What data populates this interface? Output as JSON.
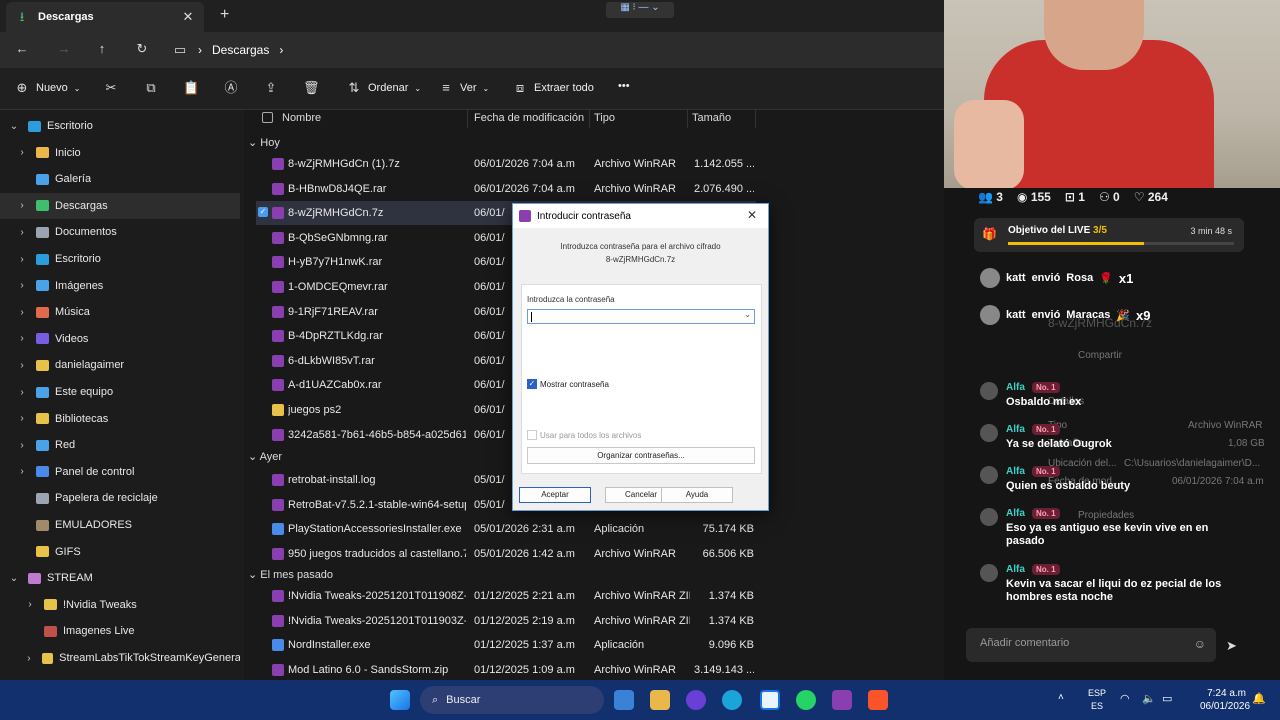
{
  "explorer": {
    "tab_title": "Descargas",
    "breadcrumb": [
      "Descargas"
    ],
    "commands": {
      "new": "Nuevo",
      "sort": "Ordenar",
      "view": "Ver",
      "extract": "Extraer todo",
      "more": "•••"
    },
    "sidebar": [
      {
        "label": "Escritorio",
        "level": 0,
        "chev": "v",
        "color": "#2d9cdb"
      },
      {
        "label": "Inicio",
        "level": 1,
        "chev": ">",
        "color": "#e8b84a"
      },
      {
        "label": "Galería",
        "level": 1,
        "chev": "",
        "color": "#4aa3e8"
      },
      {
        "label": "Descargas",
        "level": 1,
        "chev": ">",
        "color": "#3fbf6e"
      },
      {
        "label": "Documentos",
        "level": 1,
        "chev": ">",
        "color": "#9aa5b1"
      },
      {
        "label": "Escritorio",
        "level": 1,
        "chev": ">",
        "color": "#2d9cdb"
      },
      {
        "label": "Imágenes",
        "level": 1,
        "chev": ">",
        "color": "#4aa3e8"
      },
      {
        "label": "Música",
        "level": 1,
        "chev": ">",
        "color": "#e06a4a"
      },
      {
        "label": "Videos",
        "level": 1,
        "chev": ">",
        "color": "#7a5ce0"
      },
      {
        "label": "danielagaimer",
        "level": 1,
        "chev": ">",
        "color": "#e8c14a"
      },
      {
        "label": "Este equipo",
        "level": 1,
        "chev": ">",
        "color": "#4aa3e8"
      },
      {
        "label": "Bibliotecas",
        "level": 1,
        "chev": ">",
        "color": "#e8c14a"
      },
      {
        "label": "Red",
        "level": 1,
        "chev": ">",
        "color": "#4aa3e8"
      },
      {
        "label": "Panel de control",
        "level": 1,
        "chev": ">",
        "color": "#4a8ae8"
      },
      {
        "label": "Papelera de reciclaje",
        "level": 1,
        "chev": "",
        "color": "#9aa5b1"
      },
      {
        "label": "EMULADORES",
        "level": 1,
        "chev": "",
        "color": "#a08a6a"
      },
      {
        "label": "GIFS",
        "level": 1,
        "chev": "",
        "color": "#e8c14a"
      },
      {
        "label": "STREAM",
        "level": 0,
        "chev": "v",
        "color": "#c07ad0"
      },
      {
        "label": "!Nvidia Tweaks",
        "level": 2,
        "chev": ">",
        "color": "#e8c14a"
      },
      {
        "label": "Imagenes Live",
        "level": 2,
        "chev": "",
        "color": "#c0504a"
      },
      {
        "label": "StreamLabsTikTokStreamKeyGeneratorRe",
        "level": 2,
        "chev": ">",
        "color": "#e8c14a"
      }
    ],
    "columns": [
      "Nombre",
      "Fecha de modificación",
      "Tipo",
      "Tamaño"
    ],
    "groups": [
      {
        "title": "Hoy",
        "files": [
          {
            "name": "8-wZjRMHGdCn (1).7z",
            "date": "06/01/2026 7:04 a.m",
            "type": "Archivo WinRAR",
            "size": "1.142.055 ..."
          },
          {
            "name": "B-HBnwD8J4QE.rar",
            "date": "06/01/2026 7:04 a.m",
            "type": "Archivo WinRAR",
            "size": "2.076.490 ..."
          },
          {
            "name": "8-wZjRMHGdCn.7z",
            "date": "06/01/",
            "type": "",
            "size": "",
            "selected": true
          },
          {
            "name": "B-QbSeGNbmng.rar",
            "date": "06/01/",
            "type": "",
            "size": ""
          },
          {
            "name": "H-yB7y7H1nwK.rar",
            "date": "06/01/",
            "type": "",
            "size": ""
          },
          {
            "name": "1-OMDCEQmevr.rar",
            "date": "06/01/",
            "type": "",
            "size": ""
          },
          {
            "name": "9-1RjF71REAV.rar",
            "date": "06/01/",
            "type": "",
            "size": ""
          },
          {
            "name": "B-4DpRZTLKdg.rar",
            "date": "06/01/",
            "type": "",
            "size": ""
          },
          {
            "name": "6-dLkbWI85vT.rar",
            "date": "06/01/",
            "type": "",
            "size": ""
          },
          {
            "name": "A-d1UAZCab0x.rar",
            "date": "06/01/",
            "type": "",
            "size": ""
          },
          {
            "name": "juegos ps2",
            "date": "06/01/",
            "type": "",
            "size": ""
          },
          {
            "name": "3242a581-7b61-46b5-b854-a025d611...",
            "date": "06/01/",
            "type": "",
            "size": ""
          }
        ]
      },
      {
        "title": "Ayer",
        "files": [
          {
            "name": "retrobat-install.log",
            "date": "05/01/",
            "type": "",
            "size": ""
          },
          {
            "name": "RetroBat-v7.5.2.1-stable-win64-setup...",
            "date": "05/01/",
            "type": "",
            "size": ""
          },
          {
            "name": "PlayStationAccessoriesInstaller.exe",
            "date": "05/01/2026 2:31 a.m",
            "type": "Aplicación",
            "size": "75.174 KB"
          },
          {
            "name": "950 juegos traducidos al castellano.7z",
            "date": "05/01/2026 1:42 a.m",
            "type": "Archivo WinRAR",
            "size": "66.506 KB"
          }
        ]
      },
      {
        "title": "El mes pasado",
        "files": [
          {
            "name": "!Nvidia Tweaks-20251201T011908Z-1-...",
            "date": "01/12/2025 2:21 a.m",
            "type": "Archivo WinRAR ZIP",
            "size": "1.374 KB"
          },
          {
            "name": "!Nvidia Tweaks-20251201T011903Z-1-...",
            "date": "01/12/2025 2:19 a.m",
            "type": "Archivo WinRAR ZIP",
            "size": "1.374 KB"
          },
          {
            "name": "NordInstaller.exe",
            "date": "01/12/2025 1:37 a.m",
            "type": "Aplicación",
            "size": "9.096 KB"
          },
          {
            "name": "Mod Latino 6.0 - SandsStorm.zip",
            "date": "01/12/2025 1:09 a.m",
            "type": "Archivo WinRAR",
            "size": "3.149.143 ..."
          }
        ]
      }
    ]
  },
  "dialog": {
    "title": "Introducir contraseña",
    "message_line1": "Introduzca contraseña para el archivo cifrado",
    "message_line2": "8-wZjRMHGdCn.7z",
    "field_label": "Introduzca la contraseña",
    "password_value": "",
    "show_password_label": "Mostrar contraseña",
    "show_password_checked": true,
    "all_archives_label": "Usar para todos los archivos",
    "organize_label": "Organizar contraseñas...",
    "ok": "Aceptar",
    "cancel": "Cancelar",
    "help": "Ayuda"
  },
  "tiktok": {
    "stats": {
      "users": "3",
      "views": "155",
      "gifts": "1",
      "shares": "0",
      "likes": "264"
    },
    "goal": {
      "label": "Objetivo del LIVE",
      "progress": "3/5",
      "time": "3 min 48 s",
      "fraction": 0.6
    },
    "gifts": [
      {
        "user": "katt",
        "action": "envió",
        "gift": "Rosa",
        "count": "x1",
        "emoji": "🌹"
      },
      {
        "user": "katt",
        "action": "envió",
        "gift": "Maracas",
        "count": "x9",
        "emoji": "🎉"
      }
    ],
    "comments": [
      {
        "user": "Alfa",
        "badge": "No. 1",
        "text": "Osbaldo mi ex"
      },
      {
        "user": "Alfa",
        "badge": "No. 1",
        "text": "Ya se delató Ougrok"
      },
      {
        "user": "Alfa",
        "badge": "No. 1",
        "text": "Quien es osbaldo beuty"
      },
      {
        "user": "Alfa",
        "badge": "No. 1",
        "text": "Eso ya es antiguo ese kevin vive en en pasado"
      },
      {
        "user": "Alfa",
        "badge": "No. 1",
        "text": "Kevin va sacar el liqui do ez pecial de los hombres esta noche"
      }
    ],
    "input_placeholder": "Añadir comentario",
    "ghost": {
      "file": "8-wZjRMHGdCn.7z",
      "share": "Compartir",
      "details": "Detalles",
      "type_label": "Tipo",
      "type_value": "Archivo WinRAR",
      "size_label": "Tamaño",
      "size_value": "1,08 GB",
      "loc_label": "Ubicación del...",
      "loc_value": "C:\\Usuarios\\danielagaimer\\D...",
      "date_label": "Fecha de mod...",
      "date_value": "06/01/2026 7:04 a.m",
      "props": "Propiedades"
    }
  },
  "taskbar": {
    "search": "Buscar",
    "lang1": "ESP",
    "lang2": "ES",
    "time": "7:24 a.m",
    "date": "06/01/2026"
  }
}
